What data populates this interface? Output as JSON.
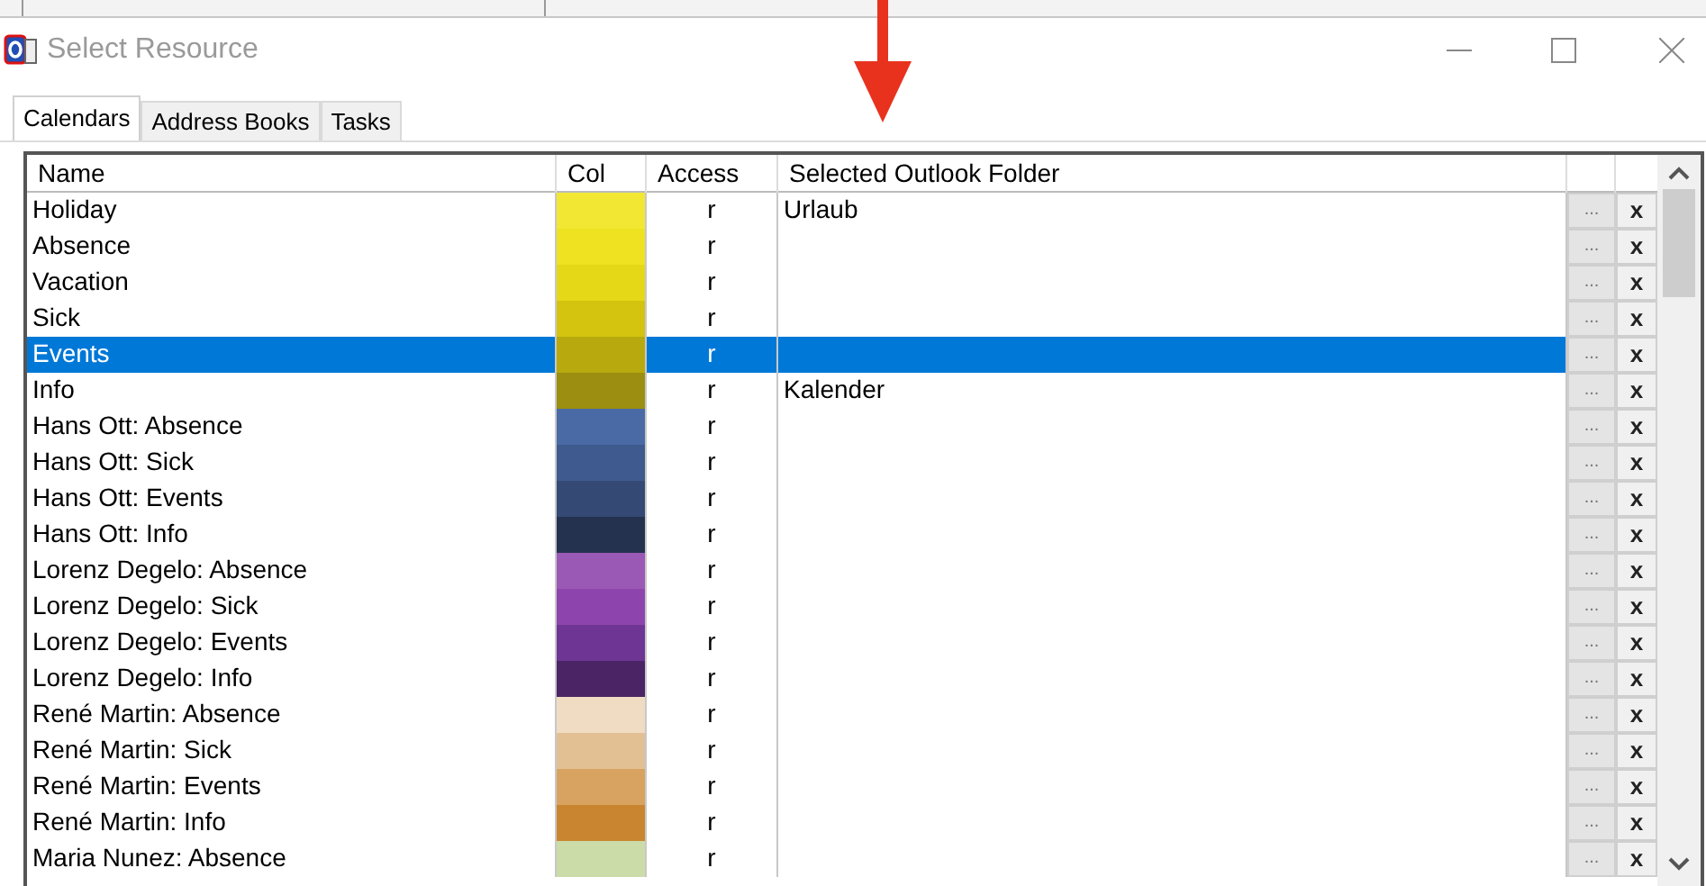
{
  "window": {
    "title": "Select Resource"
  },
  "tabs": [
    {
      "label": "Calendars",
      "selected": true
    },
    {
      "label": "Address Books",
      "selected": false
    },
    {
      "label": "Tasks",
      "selected": false
    }
  ],
  "table": {
    "columns": [
      "Name",
      "Col",
      "Access",
      "Selected Outlook Folder"
    ],
    "rows": [
      {
        "name": "Holiday",
        "color": "#f2e833",
        "access": "r",
        "folder": "Urlaub",
        "browse": "...",
        "remove": "x",
        "selected": false
      },
      {
        "name": "Absence",
        "color": "#eee221",
        "access": "r",
        "browse": "...",
        "remove": "x",
        "selected": false
      },
      {
        "name": "Vacation",
        "color": "#e5d817",
        "access": "r",
        "browse": "...",
        "remove": "x",
        "selected": false
      },
      {
        "name": "Sick",
        "color": "#d4c30f",
        "access": "r",
        "browse": "...",
        "remove": "x",
        "selected": false
      },
      {
        "name": "Events",
        "color": "#b8aa0e",
        "access": "r",
        "browse": "...",
        "remove": "x",
        "selected": true
      },
      {
        "name": "Info",
        "color": "#9c8e10",
        "access": "r",
        "folder": "Kalender",
        "browse": "...",
        "remove": "x",
        "selected": false
      },
      {
        "name": "Hans Ott: Absence",
        "color": "#4a6aa5",
        "access": "r",
        "browse": "...",
        "remove": "x",
        "selected": false
      },
      {
        "name": "Hans Ott: Sick",
        "color": "#3f5a8e",
        "access": "r",
        "browse": "...",
        "remove": "x",
        "selected": false
      },
      {
        "name": "Hans Ott: Events",
        "color": "#344a74",
        "access": "r",
        "browse": "...",
        "remove": "x",
        "selected": false
      },
      {
        "name": "Hans Ott: Info",
        "color": "#24324f",
        "access": "r",
        "browse": "...",
        "remove": "x",
        "selected": false
      },
      {
        "name": "Lorenz Degelo: Absence",
        "color": "#9b59b6",
        "access": "r",
        "browse": "...",
        "remove": "x",
        "selected": false
      },
      {
        "name": "Lorenz Degelo: Sick",
        "color": "#8e44ad",
        "access": "r",
        "browse": "...",
        "remove": "x",
        "selected": false
      },
      {
        "name": "Lorenz Degelo: Events",
        "color": "#6f3594",
        "access": "r",
        "browse": "...",
        "remove": "x",
        "selected": false
      },
      {
        "name": "Lorenz Degelo: Info",
        "color": "#4b2466",
        "access": "r",
        "browse": "...",
        "remove": "x",
        "selected": false
      },
      {
        "name": "René Martin: Absence",
        "color": "#f0dcc2",
        "access": "r",
        "browse": "...",
        "remove": "x",
        "selected": false
      },
      {
        "name": "René Martin: Sick",
        "color": "#e3c094",
        "access": "r",
        "browse": "...",
        "remove": "x",
        "selected": false
      },
      {
        "name": "René Martin: Events",
        "color": "#d8a360",
        "access": "r",
        "browse": "...",
        "remove": "x",
        "selected": false
      },
      {
        "name": "René Martin: Info",
        "color": "#c98530",
        "access": "r",
        "browse": "...",
        "remove": "x",
        "selected": false
      },
      {
        "name": "Maria Nunez: Absence",
        "color": "#cbdca8",
        "access": "r",
        "browse": "...",
        "remove": "x",
        "selected": false
      }
    ]
  }
}
